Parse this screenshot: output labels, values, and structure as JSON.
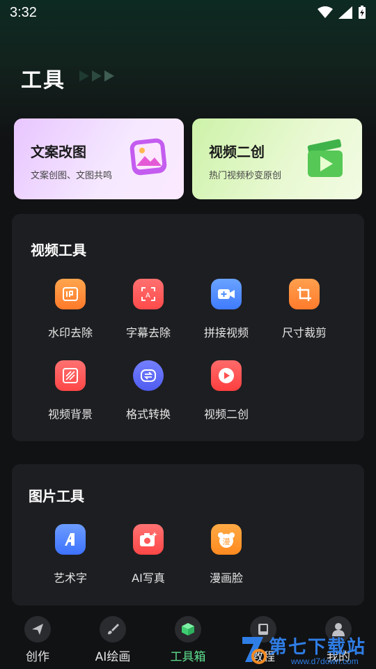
{
  "status": {
    "time": "3:32"
  },
  "header": {
    "title": "工具"
  },
  "promos": [
    {
      "title": "文案改图",
      "subtitle": "文案创图、文图共鸣"
    },
    {
      "title": "视频二创",
      "subtitle": "热门视频秒变原创"
    }
  ],
  "video_tools": {
    "title": "视频工具",
    "items": [
      {
        "label": "水印去除",
        "icon": "watermark-remove-icon",
        "color": "#ff8f3c"
      },
      {
        "label": "字幕去除",
        "icon": "subtitle-remove-icon",
        "color": "#ff5b5b"
      },
      {
        "label": "拼接视频",
        "icon": "video-join-icon",
        "color": "#4d8dff"
      },
      {
        "label": "尺寸裁剪",
        "icon": "crop-icon",
        "color": "#ff8a3a"
      },
      {
        "label": "视频背景",
        "icon": "video-background-icon",
        "color": "#ff5757"
      },
      {
        "label": "格式转换",
        "icon": "format-convert-icon",
        "color": "#5a6cff"
      },
      {
        "label": "视频二创",
        "icon": "video-remix-icon",
        "color": "#ff4f4f"
      }
    ]
  },
  "image_tools": {
    "title": "图片工具",
    "items": [
      {
        "label": "艺术字",
        "icon": "art-text-icon",
        "color": "#4d86ff"
      },
      {
        "label": "AI写真",
        "icon": "ai-portrait-icon",
        "color": "#ff5a5a"
      },
      {
        "label": "漫画脸",
        "icon": "comic-face-icon",
        "color": "#ff9a2e"
      }
    ]
  },
  "nav": {
    "items": [
      {
        "label": "创作",
        "icon": "paper-plane-icon"
      },
      {
        "label": "AI绘画",
        "icon": "brush-icon"
      },
      {
        "label": "工具箱",
        "icon": "toolbox-cube-icon",
        "active": true
      },
      {
        "label": "教程",
        "icon": "book-icon"
      },
      {
        "label": "我的",
        "icon": "user-icon"
      }
    ]
  },
  "watermark": {
    "text": "第七下载站",
    "url": "www.d7down.com"
  }
}
